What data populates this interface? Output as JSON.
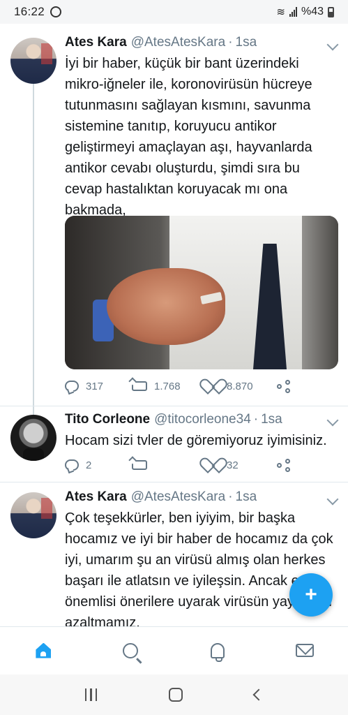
{
  "status_bar": {
    "time": "16:22",
    "battery_text": "%43",
    "icons": [
      "whatsapp-icon",
      "wifi-icon",
      "signal-icon",
      "battery-icon"
    ]
  },
  "tweets": [
    {
      "name": "Ates Kara",
      "handle": "@AtesAtesKara",
      "separator": "·",
      "time": "1sa",
      "text": "İyi bir haber, küçük bir bant üzerindeki mikro-iğneler ile, koronovirüsün hücreye tutunmasını sağlayan kısmını, savunma sistemine tanıtıp, koruyucu antikor geliştirmeyi amaçlayan aşı, hayvanlarda antikor cevabı oluşturdu, şimdi sıra bu cevap hastalıktan koruyacak mı ona bakmada,",
      "has_media": true,
      "replies": "317",
      "retweets": "1.768",
      "likes": "8.870"
    },
    {
      "name": "Tito Corleone",
      "handle": "@titocorleone34",
      "separator": "·",
      "time": "1sa",
      "text": "Hocam sizi tvler de göremiyoruz iyimisiniz.",
      "replies": "2",
      "retweets": "",
      "likes": "32"
    },
    {
      "name": "Ates Kara",
      "handle": "@AtesAtesKara",
      "separator": "·",
      "time": "1sa",
      "text": "Çok teşekkürler, ben iyiyim, bir başka hocamız ve iyi bir haber de hocamız da çok iyi, umarım şu an virüsü almış olan herkes başarı ile atlatsın ve iyileşsin. Ancak en önemlisi önerilere uyarak virüsün yayılımını azaltmamız."
    }
  ],
  "fab": {
    "label": "+",
    "icon": "compose-tweet-icon"
  },
  "tab_bar": [
    "home-icon",
    "search-icon",
    "notifications-icon",
    "messages-icon"
  ],
  "colors": {
    "accent": "#1da1f2",
    "secondary_text": "#657786",
    "divider": "#e1e8ed"
  }
}
